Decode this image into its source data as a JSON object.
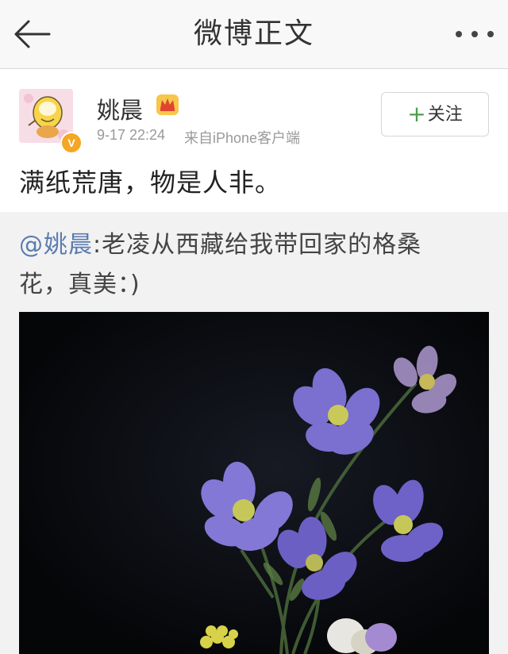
{
  "nav": {
    "title": "微博正文",
    "back_icon": "arrow-left-icon",
    "more_icon": "more-dots-icon"
  },
  "post": {
    "username": "姚晨",
    "time": "9-17 22:24",
    "source": "来自iPhone客户端",
    "verify_badge": "V",
    "follow_plus": "+",
    "follow_label": "关注",
    "text": "满纸荒唐，物是人非。"
  },
  "repost": {
    "mention": "@姚晨",
    "text_line1": ":老凌从西藏给我带回家的格桑",
    "text_line2": "花，真美：)"
  },
  "colors": {
    "accent_link": "#5b7bb0",
    "follow_plus": "#4a9e4a",
    "verify_badge": "#f5a623",
    "flower_petal": "#7b6fd0"
  }
}
